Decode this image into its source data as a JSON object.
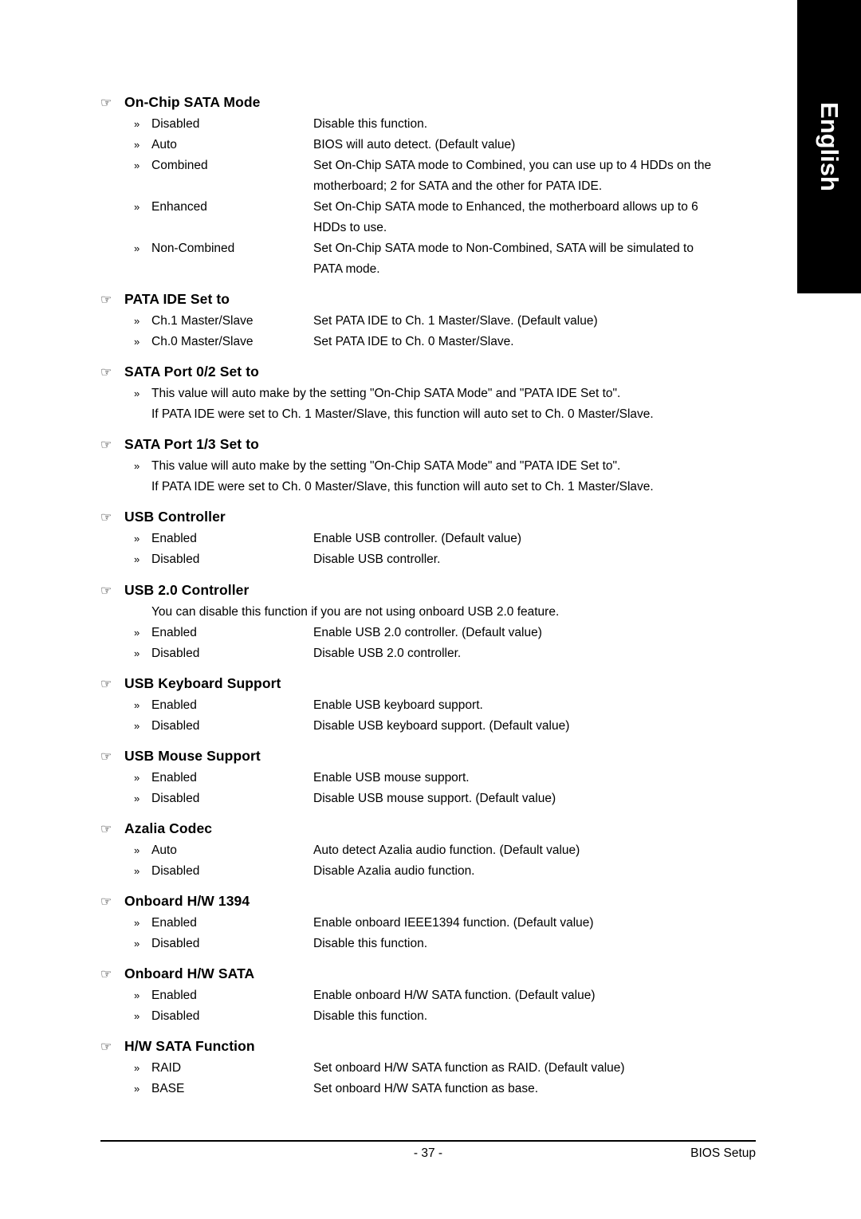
{
  "side_tab": {
    "label": "English"
  },
  "icons": {
    "hand": "☞",
    "arrow": "»"
  },
  "sections": [
    {
      "title": "On-Chip SATA Mode",
      "options": [
        {
          "name": "Disabled",
          "desc": "Disable this function."
        },
        {
          "name": "Auto",
          "desc": "BIOS will auto detect. (Default value)"
        },
        {
          "name": "Combined",
          "desc": "Set On-Chip SATA mode to Combined, you can use up to 4 HDDs on the",
          "cont": "motherboard; 2 for SATA and the other for PATA IDE."
        },
        {
          "name": "Enhanced",
          "desc": "Set On-Chip SATA mode to Enhanced, the motherboard allows up to 6",
          "cont": "HDDs to use."
        },
        {
          "name": "Non-Combined",
          "desc": "Set On-Chip SATA mode to Non-Combined, SATA will be simulated to",
          "cont": "PATA mode."
        }
      ]
    },
    {
      "title": "PATA IDE Set to",
      "options": [
        {
          "name": "Ch.1 Master/Slave",
          "desc": "Set PATA IDE to Ch. 1 Master/Slave. (Default value)"
        },
        {
          "name": "Ch.0 Master/Slave",
          "desc": "Set PATA IDE to Ch. 0 Master/Slave."
        }
      ]
    },
    {
      "title": "SATA Port 0/2 Set to",
      "paragraphs": [
        {
          "arrow": true,
          "text": "This value will auto make by the setting \"On-Chip SATA Mode\" and \"PATA IDE Set to\"."
        },
        {
          "arrow": false,
          "text": "If PATA IDE were set to Ch. 1 Master/Slave, this function will auto set to Ch. 0 Master/Slave."
        }
      ]
    },
    {
      "title": "SATA Port 1/3 Set to",
      "paragraphs": [
        {
          "arrow": true,
          "text": "This value will auto make by the setting \"On-Chip SATA Mode\" and \"PATA IDE Set to\"."
        },
        {
          "arrow": false,
          "text": "If PATA IDE were set to Ch. 0 Master/Slave, this function will auto set to Ch. 1 Master/Slave."
        }
      ]
    },
    {
      "title": "USB Controller",
      "options": [
        {
          "name": "Enabled",
          "desc": "Enable USB controller. (Default value)"
        },
        {
          "name": "Disabled",
          "desc": "Disable USB controller."
        }
      ]
    },
    {
      "title": "USB 2.0 Controller",
      "paragraphs": [
        {
          "arrow": false,
          "text": "You can disable this function if you are not using onboard USB 2.0 feature."
        }
      ],
      "options": [
        {
          "name": "Enabled",
          "desc": "Enable USB 2.0 controller. (Default value)"
        },
        {
          "name": "Disabled",
          "desc": "Disable USB 2.0 controller."
        }
      ]
    },
    {
      "title": "USB Keyboard Support",
      "options": [
        {
          "name": "Enabled",
          "desc": "Enable USB keyboard support."
        },
        {
          "name": "Disabled",
          "desc": "Disable USB keyboard support. (Default value)"
        }
      ]
    },
    {
      "title": "USB Mouse Support",
      "options": [
        {
          "name": "Enabled",
          "desc": "Enable USB mouse support."
        },
        {
          "name": "Disabled",
          "desc": "Disable USB mouse support. (Default value)"
        }
      ]
    },
    {
      "title": "Azalia Codec",
      "options": [
        {
          "name": "Auto",
          "desc": "Auto detect Azalia audio function. (Default value)"
        },
        {
          "name": "Disabled",
          "desc": "Disable Azalia audio function."
        }
      ]
    },
    {
      "title": "Onboard H/W 1394",
      "options": [
        {
          "name": "Enabled",
          "desc": "Enable onboard IEEE1394 function. (Default value)"
        },
        {
          "name": "Disabled",
          "desc": "Disable this function."
        }
      ]
    },
    {
      "title": "Onboard H/W SATA",
      "options": [
        {
          "name": "Enabled",
          "desc": "Enable onboard H/W SATA function. (Default value)"
        },
        {
          "name": "Disabled",
          "desc": "Disable this function."
        }
      ]
    },
    {
      "title": "H/W SATA Function",
      "options": [
        {
          "name": "RAID",
          "desc": "Set onboard H/W SATA function as RAID. (Default value)"
        },
        {
          "name": "BASE",
          "desc": "Set onboard H/W SATA function as base."
        }
      ]
    }
  ],
  "footer": {
    "page_number": "- 37 -",
    "right_label": "BIOS Setup"
  }
}
